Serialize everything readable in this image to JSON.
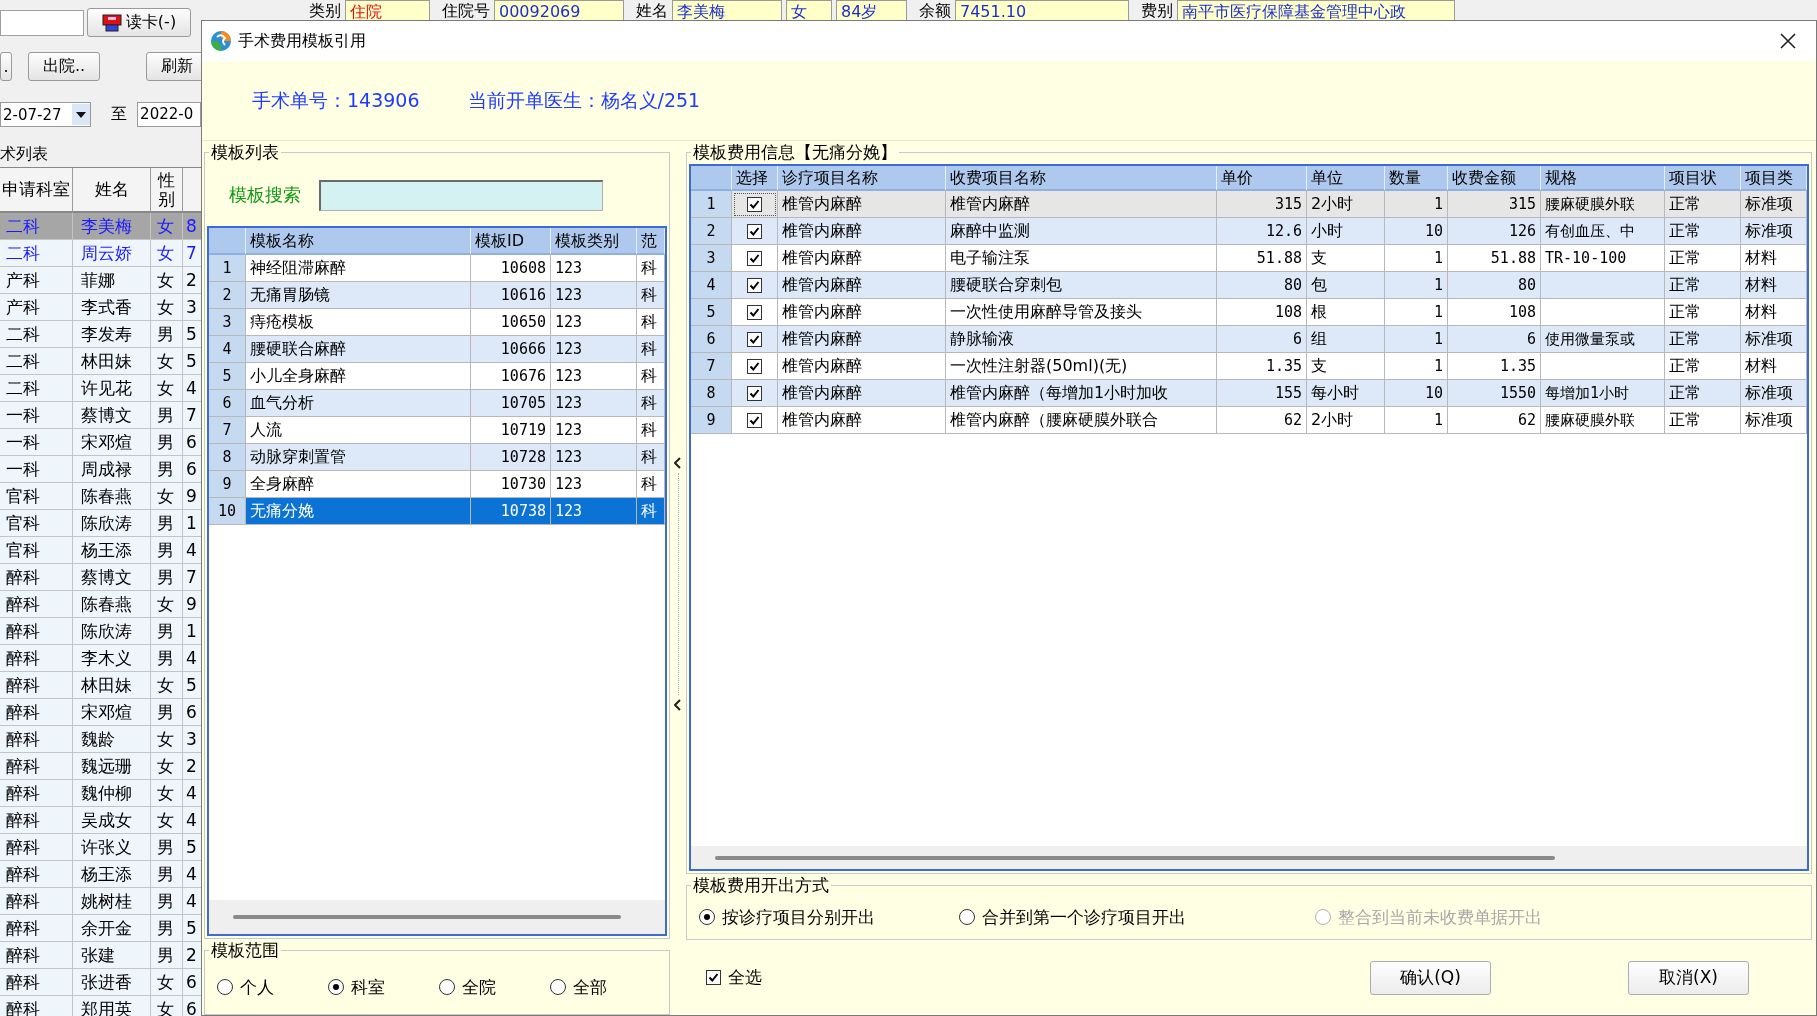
{
  "patient_bar": [
    {
      "label": "类别",
      "value": "住院",
      "alert": true
    },
    {
      "label": "住院号",
      "value": "00092069",
      "alert": false
    },
    {
      "label": "姓名",
      "value": "李美梅",
      "alert": false
    },
    {
      "value": "女",
      "alert": false
    },
    {
      "value": "84岁",
      "alert": false
    },
    {
      "label": "余额",
      "value": "7451.10",
      "alert": false
    },
    {
      "label": "费别",
      "value": "南平市医疗保障基金管理中心政",
      "alert": false
    }
  ],
  "toolbar": {
    "read_card": "读卡(-)",
    "buttons": [
      ".",
      "出院..",
      "刷新"
    ],
    "date_from": "2-07-27",
    "date_separator": "至",
    "date_to": "2022-0"
  },
  "surgery_list": {
    "title": "术列表",
    "columns": [
      "申请科室",
      "姓名",
      "性别"
    ],
    "rows": [
      {
        "dept": "二科",
        "name": "李美梅",
        "sex": "女",
        "age": "8",
        "selected": true,
        "marked": true
      },
      {
        "dept": "二科",
        "name": "周云娇",
        "sex": "女",
        "age": "7",
        "selected": false,
        "marked": true
      },
      {
        "dept": "产科",
        "name": "菲娜",
        "sex": "女",
        "age": "2",
        "selected": false,
        "marked": false
      },
      {
        "dept": "产科",
        "name": "李式香",
        "sex": "女",
        "age": "3",
        "selected": false,
        "marked": false
      },
      {
        "dept": "二科",
        "name": "李发寿",
        "sex": "男",
        "age": "5",
        "selected": false,
        "marked": false
      },
      {
        "dept": "二科",
        "name": "林田妹",
        "sex": "女",
        "age": "5",
        "selected": false,
        "marked": false
      },
      {
        "dept": "二科",
        "name": "许见花",
        "sex": "女",
        "age": "4",
        "selected": false,
        "marked": false
      },
      {
        "dept": "一科",
        "name": "蔡博文",
        "sex": "男",
        "age": "7",
        "selected": false,
        "marked": false
      },
      {
        "dept": "一科",
        "name": "宋邓煊",
        "sex": "男",
        "age": "6",
        "selected": false,
        "marked": false
      },
      {
        "dept": "一科",
        "name": "周成禄",
        "sex": "男",
        "age": "6",
        "selected": false,
        "marked": false
      },
      {
        "dept": "官科",
        "name": "陈春燕",
        "sex": "女",
        "age": "9",
        "selected": false,
        "marked": false
      },
      {
        "dept": "官科",
        "name": "陈欣涛",
        "sex": "男",
        "age": "1",
        "selected": false,
        "marked": false
      },
      {
        "dept": "官科",
        "name": "杨王添",
        "sex": "男",
        "age": "4",
        "selected": false,
        "marked": false
      },
      {
        "dept": "醉科",
        "name": "蔡博文",
        "sex": "男",
        "age": "7",
        "selected": false,
        "marked": false
      },
      {
        "dept": "醉科",
        "name": "陈春燕",
        "sex": "女",
        "age": "9",
        "selected": false,
        "marked": false
      },
      {
        "dept": "醉科",
        "name": "陈欣涛",
        "sex": "男",
        "age": "1",
        "selected": false,
        "marked": false
      },
      {
        "dept": "醉科",
        "name": "李木义",
        "sex": "男",
        "age": "4",
        "selected": false,
        "marked": false
      },
      {
        "dept": "醉科",
        "name": "林田妹",
        "sex": "女",
        "age": "5",
        "selected": false,
        "marked": false
      },
      {
        "dept": "醉科",
        "name": "宋邓煊",
        "sex": "男",
        "age": "6",
        "selected": false,
        "marked": false
      },
      {
        "dept": "醉科",
        "name": "魏龄",
        "sex": "女",
        "age": "3",
        "selected": false,
        "marked": false
      },
      {
        "dept": "醉科",
        "name": "魏远珊",
        "sex": "女",
        "age": "2",
        "selected": false,
        "marked": false
      },
      {
        "dept": "醉科",
        "name": "魏仲柳",
        "sex": "女",
        "age": "4",
        "selected": false,
        "marked": false
      },
      {
        "dept": "醉科",
        "name": "吴成女",
        "sex": "女",
        "age": "4",
        "selected": false,
        "marked": false
      },
      {
        "dept": "醉科",
        "name": "许张义",
        "sex": "男",
        "age": "5",
        "selected": false,
        "marked": false
      },
      {
        "dept": "醉科",
        "name": "杨王添",
        "sex": "男",
        "age": "4",
        "selected": false,
        "marked": false
      },
      {
        "dept": "醉科",
        "name": "姚树桂",
        "sex": "男",
        "age": "4",
        "selected": false,
        "marked": false
      },
      {
        "dept": "醉科",
        "name": "余开金",
        "sex": "男",
        "age": "5",
        "selected": false,
        "marked": false
      },
      {
        "dept": "醉科",
        "name": "张建",
        "sex": "男",
        "age": "2",
        "selected": false,
        "marked": false
      },
      {
        "dept": "醉科",
        "name": "张进香",
        "sex": "女",
        "age": "6",
        "selected": false,
        "marked": false
      },
      {
        "dept": "醉科",
        "name": "郑用英",
        "sex": "女",
        "age": "6",
        "selected": false,
        "marked": false
      }
    ]
  },
  "dialog": {
    "title": "手术费用模板引用",
    "surgery_no": "手术单号：143906",
    "doctor": "当前开单医生：杨名义/251",
    "template_list": {
      "title": "模板列表",
      "search_label": "模板搜索",
      "columns": [
        "模板名称",
        "模板ID",
        "模板类别",
        "范"
      ],
      "rows": [
        {
          "no": "1",
          "name": "神经阻滞麻醉",
          "id": "10608",
          "category": "123",
          "scope": "科",
          "selected": false
        },
        {
          "no": "2",
          "name": "无痛胃肠镜",
          "id": "10616",
          "category": "123",
          "scope": "科",
          "selected": false
        },
        {
          "no": "3",
          "name": "痔疮模板",
          "id": "10650",
          "category": "123",
          "scope": "科",
          "selected": false
        },
        {
          "no": "4",
          "name": "腰硬联合麻醉",
          "id": "10666",
          "category": "123",
          "scope": "科",
          "selected": false
        },
        {
          "no": "5",
          "name": "小儿全身麻醉",
          "id": "10676",
          "category": "123",
          "scope": "科",
          "selected": false
        },
        {
          "no": "6",
          "name": "血气分析",
          "id": "10705",
          "category": "123",
          "scope": "科",
          "selected": false
        },
        {
          "no": "7",
          "name": "人流",
          "id": "10719",
          "category": "123",
          "scope": "科",
          "selected": false
        },
        {
          "no": "8",
          "name": "动脉穿刺置管",
          "id": "10728",
          "category": "123",
          "scope": "科",
          "selected": false
        },
        {
          "no": "9",
          "name": "全身麻醉",
          "id": "10730",
          "category": "123",
          "scope": "科",
          "selected": false
        },
        {
          "no": "10",
          "name": "无痛分娩",
          "id": "10738",
          "category": "123",
          "scope": "科",
          "selected": true
        }
      ]
    },
    "scope": {
      "title": "模板范围",
      "options": [
        {
          "label": "个人",
          "selected": false
        },
        {
          "label": "科室",
          "selected": true
        },
        {
          "label": "全院",
          "selected": false
        },
        {
          "label": "全部",
          "selected": false
        }
      ]
    },
    "fee_info": {
      "title": "模板费用信息【无痛分娩】",
      "columns": [
        "选择",
        "诊疗项目名称",
        "收费项目名称",
        "单价",
        "单位",
        "数量",
        "收费金额",
        "规格",
        "项目状",
        "项目类"
      ],
      "rows": [
        {
          "no": "1",
          "checked": true,
          "focused": true,
          "treatment": "椎管内麻醉",
          "item": "椎管内麻醉",
          "price": "315",
          "unit": "2小时",
          "qty": "1",
          "amount": "315",
          "spec": "腰麻硬膜外联",
          "status": "正常",
          "category": "标准项"
        },
        {
          "no": "2",
          "checked": true,
          "focused": false,
          "treatment": "椎管内麻醉",
          "item": "麻醉中监测",
          "price": "12.6",
          "unit": "小时",
          "qty": "10",
          "amount": "126",
          "spec": "有创血压、中",
          "status": "正常",
          "category": "标准项"
        },
        {
          "no": "3",
          "checked": true,
          "focused": false,
          "treatment": "椎管内麻醉",
          "item": "电子输注泵",
          "price": "51.88",
          "unit": "支",
          "qty": "1",
          "amount": "51.88",
          "spec": "TR-10-100",
          "status": "正常",
          "category": "材料"
        },
        {
          "no": "4",
          "checked": true,
          "focused": false,
          "treatment": "椎管内麻醉",
          "item": "腰硬联合穿刺包",
          "price": "80",
          "unit": "包",
          "qty": "1",
          "amount": "80",
          "spec": "",
          "status": "正常",
          "category": "材料"
        },
        {
          "no": "5",
          "checked": true,
          "focused": false,
          "treatment": "椎管内麻醉",
          "item": "一次性使用麻醉导管及接头",
          "price": "108",
          "unit": "根",
          "qty": "1",
          "amount": "108",
          "spec": "",
          "status": "正常",
          "category": "材料"
        },
        {
          "no": "6",
          "checked": true,
          "focused": false,
          "treatment": "椎管内麻醉",
          "item": "静脉输液",
          "price": "6",
          "unit": "组",
          "qty": "1",
          "amount": "6",
          "spec": "使用微量泵或",
          "status": "正常",
          "category": "标准项"
        },
        {
          "no": "7",
          "checked": true,
          "focused": false,
          "treatment": "椎管内麻醉",
          "item": "一次性注射器(50ml)(无)",
          "price": "1.35",
          "unit": "支",
          "qty": "1",
          "amount": "1.35",
          "spec": "",
          "status": "正常",
          "category": "材料"
        },
        {
          "no": "8",
          "checked": true,
          "focused": false,
          "treatment": "椎管内麻醉",
          "item": "椎管内麻醉（每增加1小时加收",
          "price": "155",
          "unit": "每小时",
          "qty": "10",
          "amount": "1550",
          "spec": "每增加1小时",
          "status": "正常",
          "category": "标准项"
        },
        {
          "no": "9",
          "checked": true,
          "focused": false,
          "treatment": "椎管内麻醉",
          "item": "椎管内麻醉（腰麻硬膜外联合",
          "price": "62",
          "unit": "2小时",
          "qty": "1",
          "amount": "62",
          "spec": "腰麻硬膜外联",
          "status": "正常",
          "category": "标准项"
        }
      ]
    },
    "billing_method": {
      "title": "模板费用开出方式",
      "options": [
        {
          "label": "按诊疗项目分别开出",
          "selected": true,
          "disabled": false
        },
        {
          "label": "合并到第一个诊疗项目开出",
          "selected": false,
          "disabled": false
        },
        {
          "label": "整合到当前未收费单据开出",
          "selected": false,
          "disabled": true
        }
      ]
    },
    "select_all": {
      "label": "全选",
      "checked": true
    },
    "buttons": [
      "确认(Q)",
      "取消(X)"
    ]
  }
}
